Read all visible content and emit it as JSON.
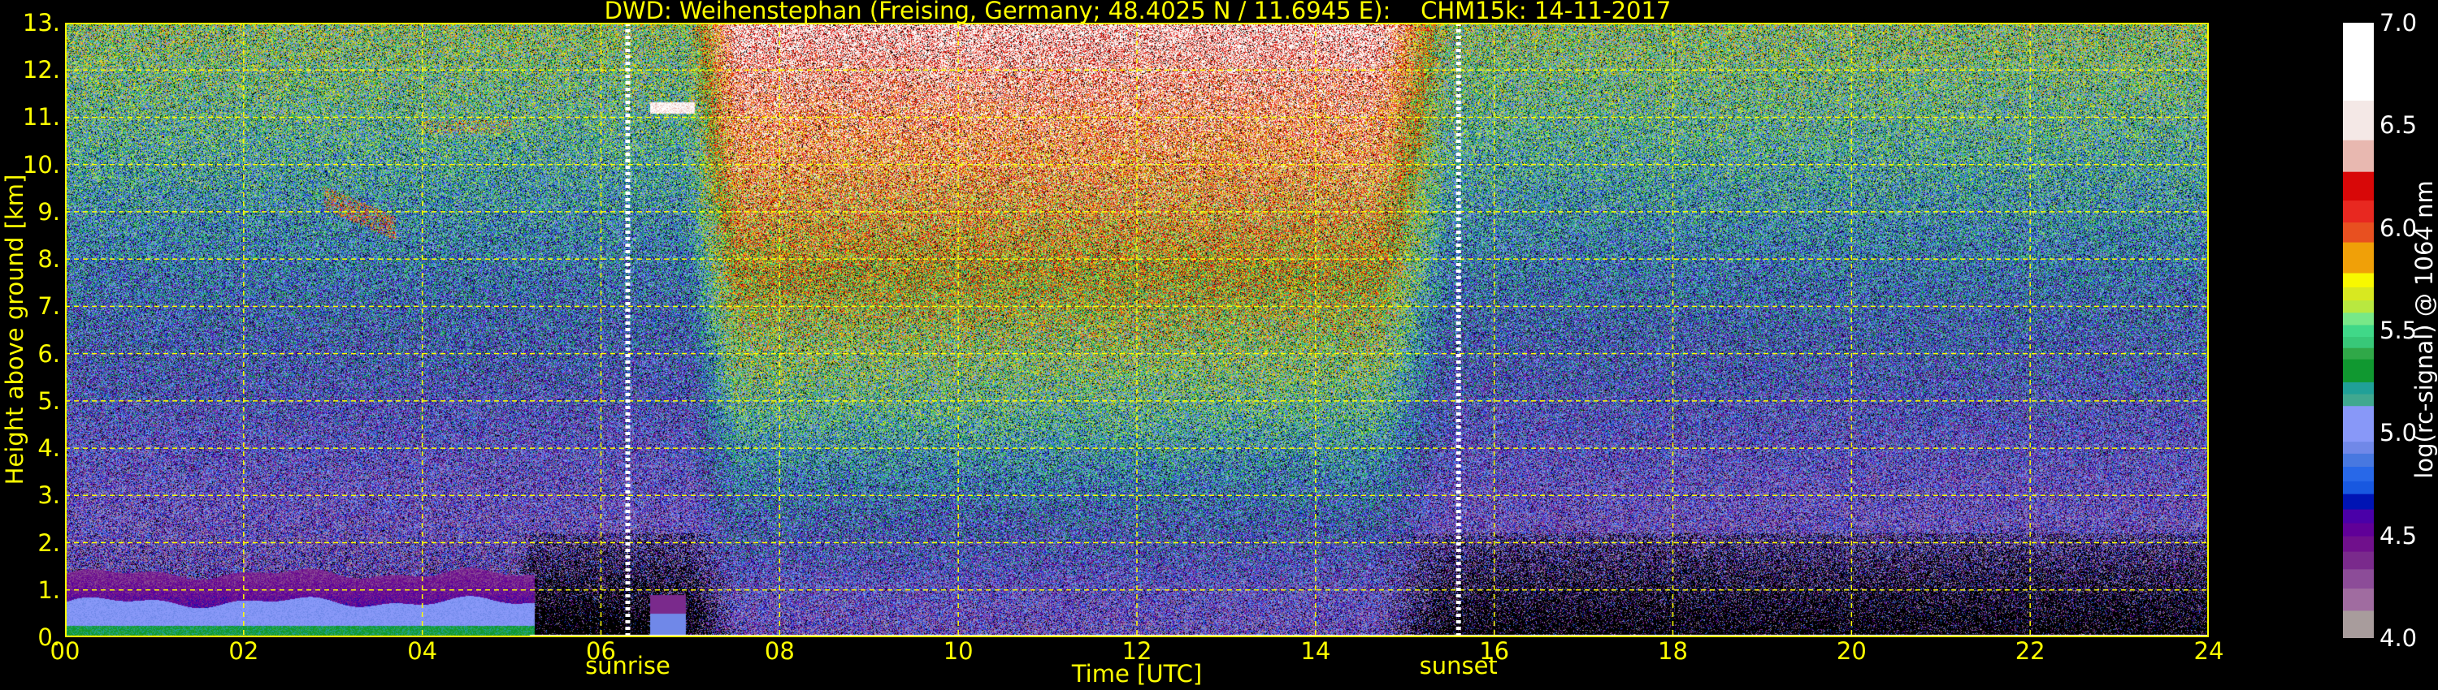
{
  "chart_data": {
    "type": "heatmap",
    "title": "DWD: Weihenstephan (Freising, Germany; 48.4025 N / 11.6945 E):    CHM15k: 14-11-2017",
    "xlabel": "Time [UTC]",
    "ylabel": "Height above ground [km]",
    "xlim": [
      0,
      24
    ],
    "ylim": [
      0,
      13
    ],
    "x_ticks": [
      "00",
      "02",
      "04",
      "06",
      "08",
      "10",
      "12",
      "14",
      "16",
      "18",
      "20",
      "22",
      "24"
    ],
    "y_ticks": [
      "0.",
      "1.",
      "2.",
      "3.",
      "4.",
      "5.",
      "6.",
      "7.",
      "8.",
      "9.",
      "10.",
      "11.",
      "12.",
      "13."
    ],
    "grid": true,
    "events": [
      {
        "label": "sunrise",
        "time": 6.3
      },
      {
        "label": "sunset",
        "time": 15.6
      }
    ],
    "colorbar": {
      "label": "log(rc-signal) @ 1064 nm",
      "range": [
        4.0,
        7.0
      ],
      "ticks": [
        "4.0",
        "4.5",
        "5.0",
        "5.5",
        "6.0",
        "6.5",
        "7.0"
      ],
      "segments": [
        {
          "from": 4.0,
          "color": "#a89c9c"
        },
        {
          "from": 4.135,
          "color": "#a06ca0"
        },
        {
          "from": 4.243,
          "color": "#8c4c98"
        },
        {
          "from": 4.337,
          "color": "#7a2a8c"
        },
        {
          "from": 4.423,
          "color": "#70108c"
        },
        {
          "from": 4.498,
          "color": "#600098"
        },
        {
          "from": 4.562,
          "color": "#4a00a8"
        },
        {
          "from": 4.629,
          "color": "#0014b4"
        },
        {
          "from": 4.704,
          "color": "#1858e0"
        },
        {
          "from": 4.766,
          "color": "#2868e8"
        },
        {
          "from": 4.837,
          "color": "#4878e0"
        },
        {
          "from": 4.901,
          "color": "#7088e8"
        },
        {
          "from": 4.959,
          "color": "#8898f8"
        },
        {
          "from": 5.133,
          "color": "#40a890"
        },
        {
          "from": 5.191,
          "color": "#20a098"
        },
        {
          "from": 5.249,
          "color": "#109830"
        },
        {
          "from": 5.361,
          "color": "#30a848"
        },
        {
          "from": 5.416,
          "color": "#38c878"
        },
        {
          "from": 5.47,
          "color": "#40d888"
        },
        {
          "from": 5.528,
          "color": "#78e888"
        },
        {
          "from": 5.588,
          "color": "#b8e840"
        },
        {
          "from": 5.648,
          "color": "#d8e820"
        },
        {
          "from": 5.712,
          "color": "#f8f800"
        },
        {
          "from": 5.781,
          "color": "#f0a008"
        },
        {
          "from": 5.931,
          "color": "#e85020"
        },
        {
          "from": 6.028,
          "color": "#e82820"
        },
        {
          "from": 6.135,
          "color": "#d80808"
        },
        {
          "from": 6.275,
          "color": "#e8b8b0"
        },
        {
          "from": 6.429,
          "color": "#f4e8e6"
        },
        {
          "from": 6.622,
          "color": "#ffffff"
        }
      ]
    },
    "colors": {
      "axis_text": "#ffff00",
      "grid": "#ffff00",
      "background": "#000000"
    }
  }
}
